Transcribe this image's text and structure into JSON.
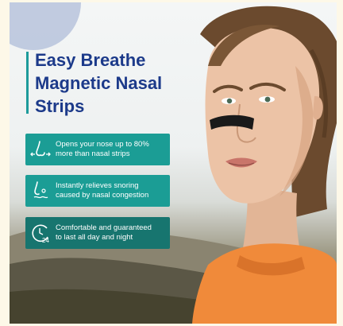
{
  "headline": {
    "line1": "Easy Breathe",
    "line2": "Magnetic Nasal",
    "line3": "Strips"
  },
  "features": [
    {
      "icon": "nose-icon",
      "line1": "Opens your nose up to 80%",
      "line2": "more than nasal strips"
    },
    {
      "icon": "snoring-icon",
      "line1": "Instantly relieves snoring",
      "line2": "caused by nasal congestion"
    },
    {
      "icon": "clock-24-icon",
      "line1": "Comfortable and guaranteed",
      "line2": "to last all day and night"
    }
  ],
  "colors": {
    "title": "#1c3a8a",
    "feature_bg": "#1b9d95",
    "feature_bg_dark": "#17756f",
    "accent_circle": "#b7c3dc",
    "shirt": "#f08a3a",
    "nasal_strip": "#1a1a1a"
  }
}
